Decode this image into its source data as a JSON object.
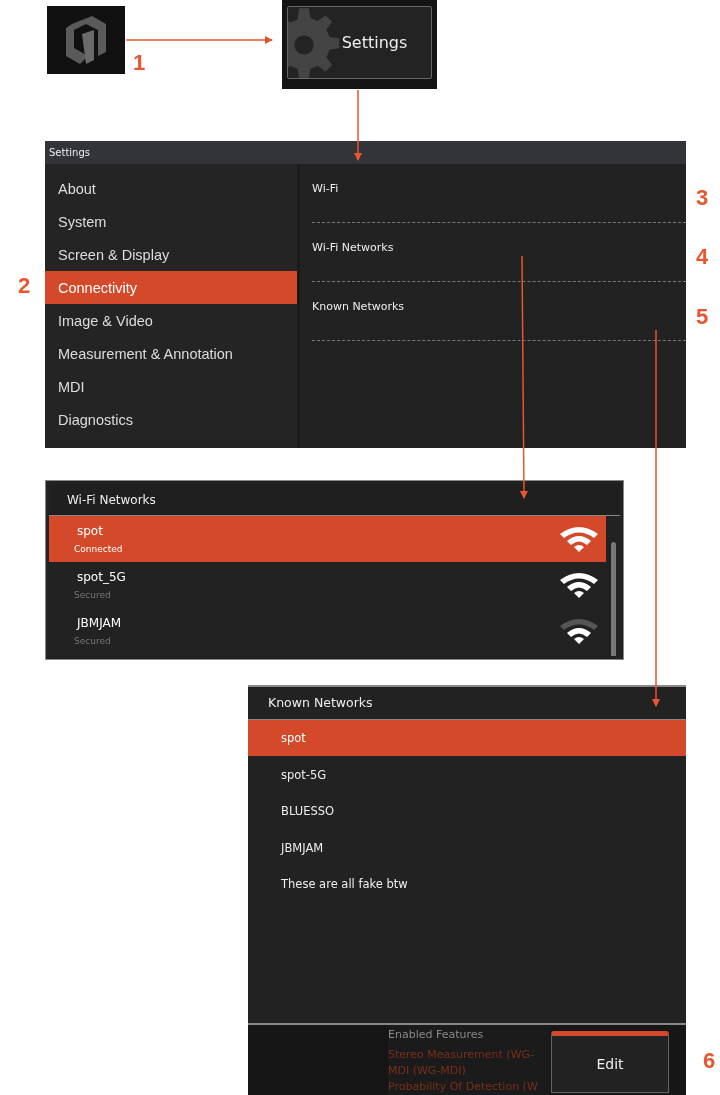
{
  "launcher": {
    "settings_button": "Settings"
  },
  "callouts": [
    "1",
    "2",
    "3",
    "4",
    "5",
    "6"
  ],
  "settings_window": {
    "title": "Settings",
    "sidebar": {
      "items": [
        {
          "label": "About",
          "selected": false
        },
        {
          "label": "System",
          "selected": false
        },
        {
          "label": "Screen & Display",
          "selected": false
        },
        {
          "label": "Connectivity",
          "selected": true
        },
        {
          "label": "Image & Video",
          "selected": false
        },
        {
          "label": "Measurement & Annotation",
          "selected": false
        },
        {
          "label": "MDI",
          "selected": false
        },
        {
          "label": "Diagnostics",
          "selected": false
        }
      ]
    },
    "sections": [
      "Wi-Fi",
      "Wi-Fi Networks",
      "Known Networks"
    ]
  },
  "wifi_networks": {
    "title": "Wi-Fi Networks",
    "rows": [
      {
        "name": "spot",
        "status": "Connected",
        "selected": true,
        "weak_signal": false
      },
      {
        "name": "spot_5G",
        "status": "Secured",
        "selected": false,
        "weak_signal": false
      },
      {
        "name": "JBMJAM",
        "status": "Secured",
        "selected": false,
        "weak_signal": true
      }
    ]
  },
  "known_networks": {
    "title": "Known Networks",
    "rows": [
      {
        "name": "spot",
        "selected": true
      },
      {
        "name": "spot-5G",
        "selected": false
      },
      {
        "name": "BLUESSO",
        "selected": false
      },
      {
        "name": "JBMJAM",
        "selected": false
      },
      {
        "name": "These are all fake btw",
        "selected": false
      }
    ],
    "features": {
      "heading": "Enabled Features",
      "items": [
        "Stereo Measurement (WG-",
        "MDI (WG-MDI)",
        "Probability Of Detection (W"
      ]
    },
    "edit_button": "Edit"
  }
}
